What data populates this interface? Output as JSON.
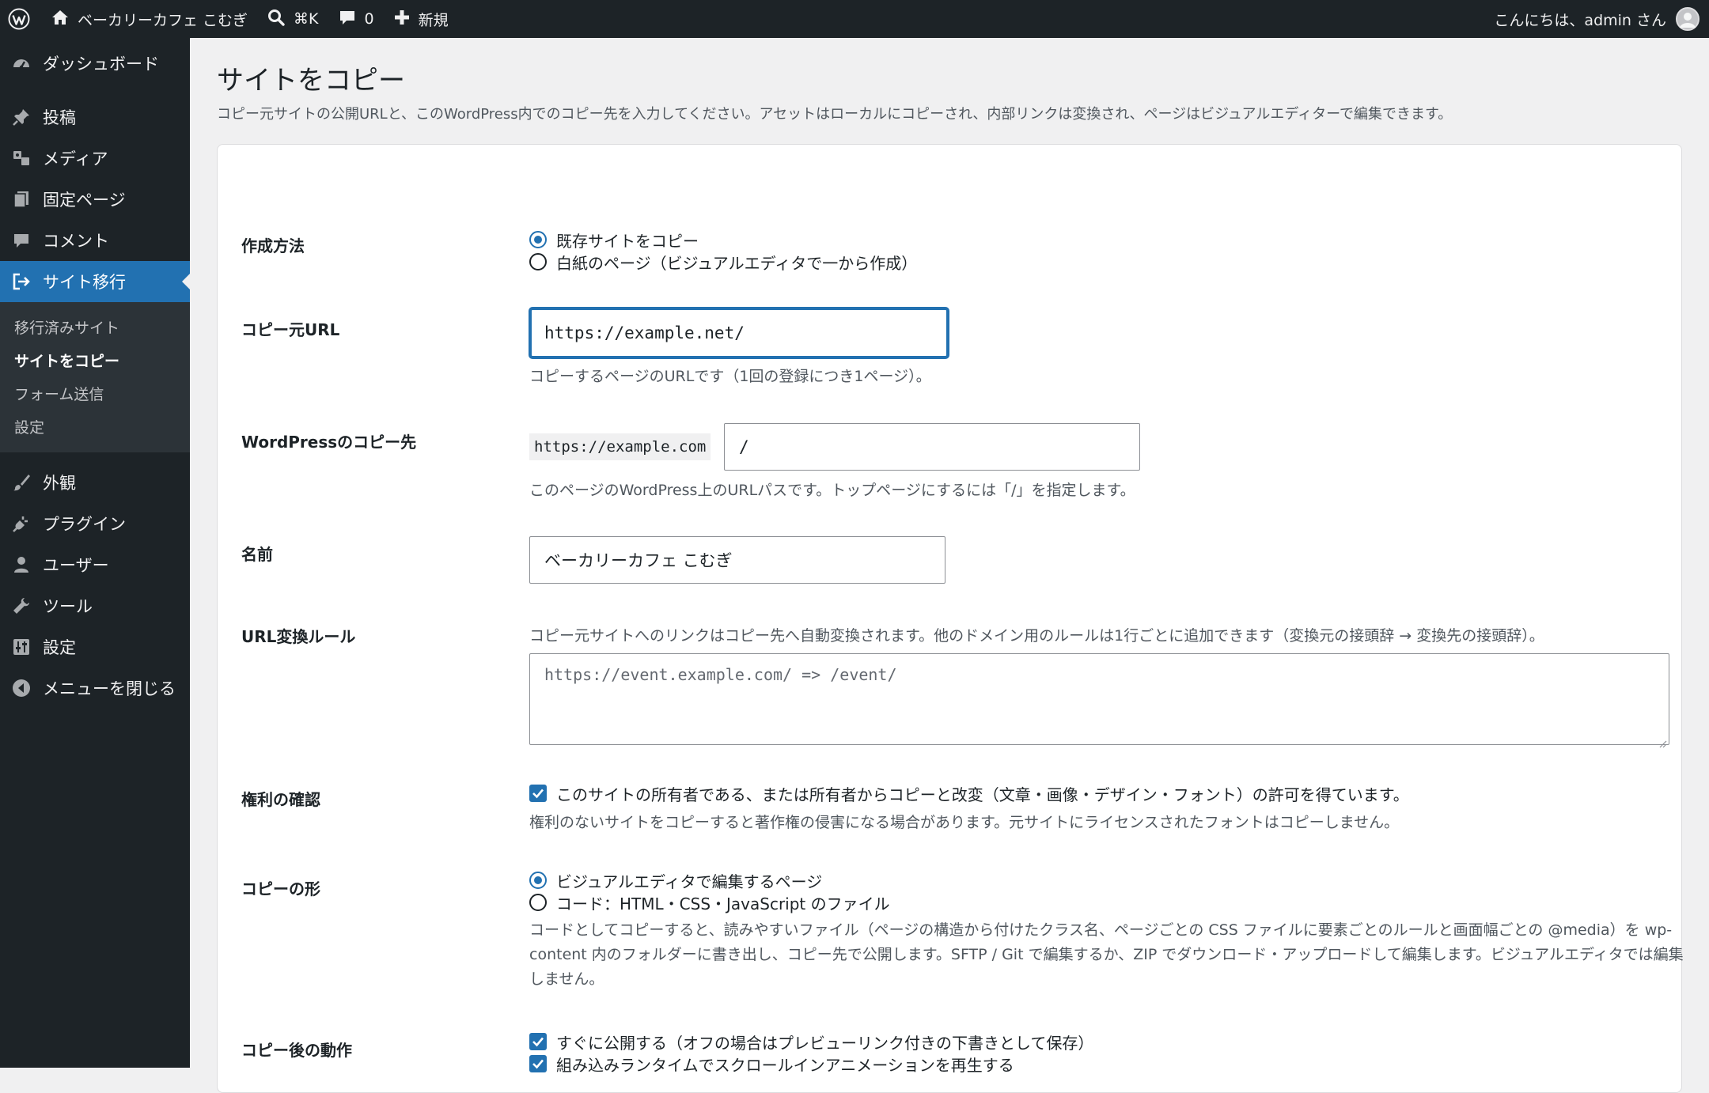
{
  "adminbar": {
    "site_name": "ベーカリーカフェ こむぎ",
    "search_shortcut": "⌘K",
    "comments_count": "0",
    "new_label": "新規",
    "greeting": "こんにちは、admin さん"
  },
  "sidebar": {
    "items_top": [
      {
        "label": "ダッシュボード",
        "icon": "dashboard-icon"
      },
      {
        "label": "投稿",
        "icon": "pin-icon"
      },
      {
        "label": "メディア",
        "icon": "media-icon"
      },
      {
        "label": "固定ページ",
        "icon": "pages-icon"
      },
      {
        "label": "コメント",
        "icon": "comment-icon"
      },
      {
        "label": "サイト移行",
        "icon": "migrate-icon"
      }
    ],
    "submenu": [
      "移行済みサイト",
      "サイトをコピー",
      "フォーム送信",
      "設定"
    ],
    "items_bottom": [
      {
        "label": "外観",
        "icon": "brush-icon"
      },
      {
        "label": "プラグイン",
        "icon": "plugin-icon"
      },
      {
        "label": "ユーザー",
        "icon": "user-icon"
      },
      {
        "label": "ツール",
        "icon": "wrench-icon"
      },
      {
        "label": "設定",
        "icon": "settings-icon"
      },
      {
        "label": "メニューを閉じる",
        "icon": "collapse-icon"
      }
    ]
  },
  "page": {
    "title": "サイトをコピー",
    "description": "コピー元サイトの公開URLと、このWordPress内でのコピー先を入力してください。アセットはローカルにコピーされ、内部リンクは変換され、ページはビジュアルエディターで編集できます。"
  },
  "form": {
    "method": {
      "label": "作成方法",
      "options": [
        "既存サイトをコピー",
        "白紙のページ（ビジュアルエディタで一から作成）"
      ],
      "selected": 0
    },
    "source_url": {
      "label": "コピー元URL",
      "value": "https://example.net/",
      "help": "コピーするページのURLです（1回の登録につき1ページ）。"
    },
    "destination": {
      "label": "WordPressのコピー先",
      "prefix": "https://example.com",
      "value": "/",
      "help": "このページのWordPress上のURLパスです。トップページにするには「/」を指定します。"
    },
    "name": {
      "label": "名前",
      "value": "ベーカリーカフェ こむぎ"
    },
    "url_rules": {
      "label": "URL変換ルール",
      "help": "コピー元サイトへのリンクはコピー先へ自動変換されます。他のドメイン用のルールは1行ごとに追加できます（変換元の接頭辞 → 変換先の接頭辞）。",
      "placeholder": "https://event.example.com/ => /event/"
    },
    "rights": {
      "label": "権利の確認",
      "checkbox_label": "このサイトの所有者である、または所有者からコピーと改変（文章・画像・デザイン・フォント）の許可を得ています。",
      "checked": true,
      "help": "権利のないサイトをコピーすると著作権の侵害になる場合があります。元サイトにライセンスされたフォントはコピーしません。"
    },
    "copy_form": {
      "label": "コピーの形",
      "options": [
        "ビジュアルエディタで編集するページ",
        "コード：HTML・CSS・JavaScript のファイル"
      ],
      "selected": 0,
      "help": "コードとしてコピーすると、読みやすいファイル（ページの構造から付けたクラス名、ページごとの CSS ファイルに要素ごとのルールと画面幅ごとの @media）を wp-content 内のフォルダーに書き出し、コピー先で公開します。SFTP / Git で編集するか、ZIP でダウンロード・アップロードして編集します。ビジュアルエディタでは編集しません。"
    },
    "after_copy": {
      "label": "コピー後の動作",
      "options": [
        {
          "label": "すぐに公開する（オフの場合はプレビューリンク付きの下書きとして保存）",
          "checked": true
        },
        {
          "label": "組み込みランタイムでスクロールインアニメーションを再生する",
          "checked": true
        }
      ]
    }
  },
  "colors": {
    "admin_bg": "#1d2327",
    "accent": "#2271b1",
    "page_bg": "#f0f0f1"
  }
}
